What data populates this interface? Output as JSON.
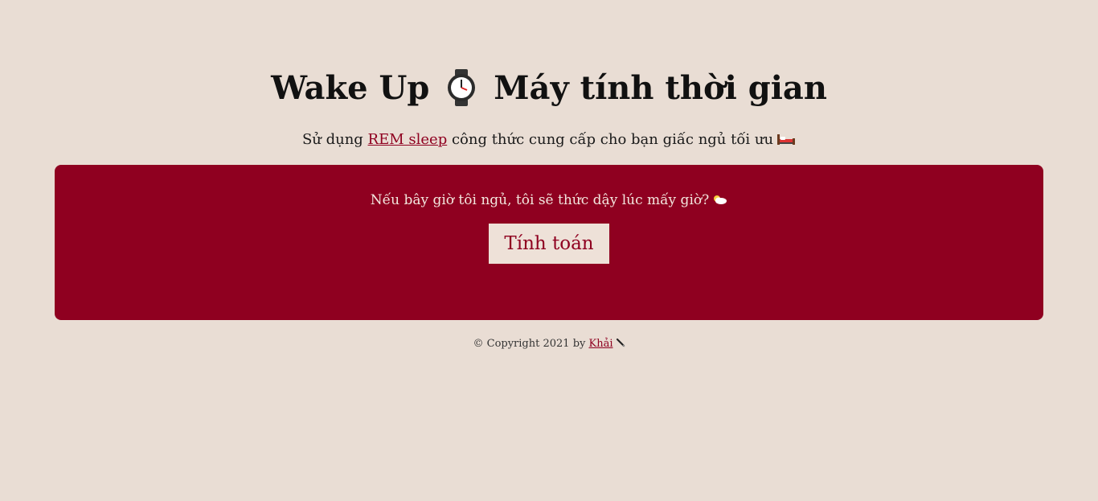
{
  "header": {
    "title_part1": "Wake Up",
    "title_icon": "watch-icon",
    "title_part2": "Máy tính thời gian"
  },
  "subtitle": {
    "prefix": "Sử dụng ",
    "link_text": "REM sleep",
    "suffix": " công thức cung cấp cho bạn giấc ngủ tối ưu",
    "icon": "bed-icon"
  },
  "calculator": {
    "question": "Nếu bây giờ tôi ngủ, tôi sẽ thức dậy lúc mấy giờ?",
    "question_icon": "cloud-icon",
    "button_label": "Tính toán"
  },
  "footer": {
    "prefix": "© Copyright 2021 by ",
    "author": "Khải",
    "icon": "pen-icon"
  },
  "colors": {
    "background": "#e9ddd4",
    "accent": "#8f0020",
    "button_bg": "#eee1d8"
  }
}
